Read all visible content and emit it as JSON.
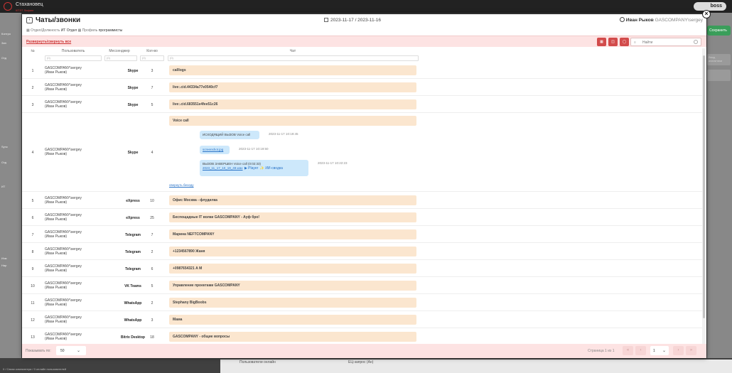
{
  "background": {
    "logo": {
      "title": "Стахановец",
      "subtitle": "КПЭТ Лифинг"
    },
    "user_pill": "boss",
    "left_menu": [
      "Контро",
      "Зап",
      "Отд",
      "Sync",
      "Отд",
      "ИТ",
      "Изм",
      "Нар"
    ],
    "right_button": "Сохранить",
    "right_hint": "Ввод аналитики",
    "bottom_labels": [
      "Пользователи онлайн",
      "ЕЦ-запрос (Ан)"
    ],
    "status_bar": "0 / Связи компьютера / 0 онлайн пользователей"
  },
  "modal": {
    "title": "Чаты/звонки",
    "date_range": "2023-11-17 / 2023-11-16",
    "user_name": "Иван Рыков",
    "user_account": "GASCOMPANY\\sergey",
    "breadcrumb": {
      "item1_label": "Отдел/Должность",
      "item1_value": "ИТ Отдел",
      "item2_label": "Профиль",
      "item2_value": "программисты"
    },
    "expand_all": "Развернуть/свернуть все",
    "search_placeholder": "Найти",
    "toolbar_icons": [
      "excel-icon",
      "columns-icon",
      "filter-icon"
    ],
    "columns": {
      "num": "№",
      "user": "Пользователь",
      "messenger": "Мессенджер",
      "count": "Кол-во",
      "chat": "Чат"
    },
    "filter_placeholders": {
      "num": "(0)",
      "user": "(0)",
      "messenger": "(0)",
      "count": "(0)",
      "chat": "(0)"
    },
    "rows": [
      {
        "num": "1",
        "user": "GASCOMPANY\\sergey",
        "user_name": "(Иван Рыков)",
        "messenger": "Skype",
        "count": "3",
        "chat": "calllogs"
      },
      {
        "num": "2",
        "user": "GASCOMPANY\\sergey",
        "user_name": "(Иван Рыков)",
        "messenger": "Skype",
        "count": "7",
        "chat": "live:.cid.44334a77e0540cf7"
      },
      {
        "num": "3",
        "user": "GASCOMPANY\\sergey",
        "user_name": "(Иван Рыков)",
        "messenger": "Skype",
        "count": "5",
        "chat": "live:.cid.683551e4fee51c26"
      },
      {
        "num": "4",
        "user": "GASCOMPANY\\sergey",
        "user_name": "(Иван Рыков)",
        "messenger": "Skype",
        "count": "4",
        "chat": "Voice call"
      },
      {
        "num": "5",
        "user": "GASCOMPANY\\sergey",
        "user_name": "(Иван Рыков)",
        "messenger": "eXpress",
        "count": "10",
        "chat": "Офис Москва - флудилка"
      },
      {
        "num": "6",
        "user": "GASCOMPANY\\sergey",
        "user_name": "(Иван Рыков)",
        "messenger": "eXpress",
        "count": "25",
        "chat": "Беспощадные IT волки GASCOMPANY - Ауф бро!"
      },
      {
        "num": "7",
        "user": "GASCOMPANY\\sergey",
        "user_name": "(Иван Рыков)",
        "messenger": "Telegram",
        "count": "7",
        "chat": "Марина NEFTCOMPANY"
      },
      {
        "num": "8",
        "user": "GASCOMPANY\\sergey",
        "user_name": "(Иван Рыков)",
        "messenger": "Telegram",
        "count": "2",
        "chat": "+1234567890 Жаня"
      },
      {
        "num": "9",
        "user": "GASCOMPANY\\sergey",
        "user_name": "(Иван Рыков)",
        "messenger": "Telegram",
        "count": "6",
        "chat": "+0987654321 А М"
      },
      {
        "num": "10",
        "user": "GASCOMPANY\\sergey",
        "user_name": "(Иван Рыков)",
        "messenger": "VK Teams",
        "count": "5",
        "chat": "Управление проектами GASCOMPANY"
      },
      {
        "num": "11",
        "user": "GASCOMPANY\\sergey",
        "user_name": "(Иван Рыков)",
        "messenger": "WhatsApp",
        "count": "2",
        "chat": "Stephany BigBoobs"
      },
      {
        "num": "12",
        "user": "GASCOMPANY\\sergey",
        "user_name": "(Иван Рыков)",
        "messenger": "WhatsApp",
        "count": "3",
        "chat": "Мама"
      },
      {
        "num": "13",
        "user": "GASCOMPANY\\sergey",
        "user_name": "(Иван Рыков)",
        "messenger": "Bitrix Desktop",
        "count": "18",
        "chat": "GASCOMPANY - общие вопросы"
      }
    ],
    "expanded_messages": [
      {
        "text": "ИСХОДЯЩИЙ ВЫЗОВ Voice call",
        "time": "2023-11-17 10:19:45"
      },
      {
        "text": "screenshot.jpg",
        "time": "2023-11-17 10:19:50"
      },
      {
        "text": "ВЫЗОВ ЗАВЕРШЕН Voice call (0:02:33)",
        "file": "2023_11_17_10_19_49.wav",
        "player": "Player",
        "summary": "ИИ-сводка",
        "time": "2023-11-17 10:22:23"
      }
    ],
    "collapse_chat": "свернуть беседу",
    "footer": {
      "per_page_label": "Показывать по:",
      "per_page_value": "50",
      "page_info": "Страница 1 из 1",
      "page_value": "1"
    }
  }
}
